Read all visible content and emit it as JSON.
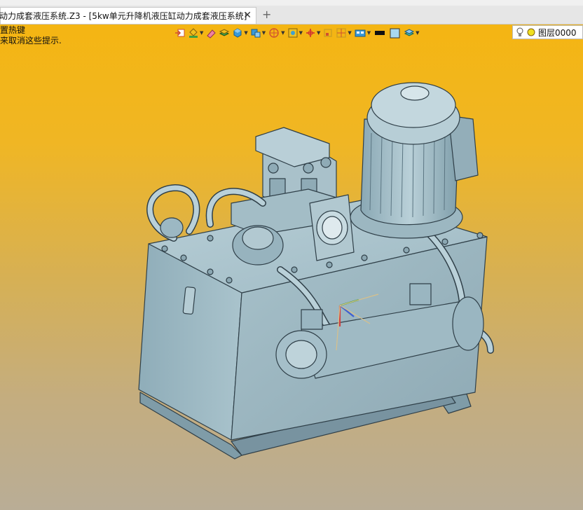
{
  "tab": {
    "title": "动力成套液压系统.Z3 - [5kw单元升降机液压缸动力成套液压系统]",
    "close_icon": "close-icon",
    "add_icon": "plus-icon"
  },
  "hint": {
    "line1": "置热键",
    "line2": "来取消这些提示."
  },
  "toolbar": {
    "icons": [
      "exit-sketch-icon",
      "paint-bucket-icon",
      "eraser-icon",
      "stack-layers-icon",
      "cube-view-icon",
      "display-mode-icon",
      "section-view-icon",
      "render-mode-icon",
      "axis-triad-icon",
      "frame-icon",
      "grid-icon",
      "view-panel-icon",
      "color-black-swatch",
      "color-lightblue-swatch",
      "layer-stack-icon"
    ]
  },
  "layer": {
    "name": "图层0000",
    "icons": [
      "bulb-icon",
      "sun-icon"
    ]
  },
  "colors": {
    "background_top": "#f5b50f",
    "background_bottom": "#b9ad96",
    "model_fill": "#9ab7c2",
    "model_edge": "#2f3f48"
  }
}
